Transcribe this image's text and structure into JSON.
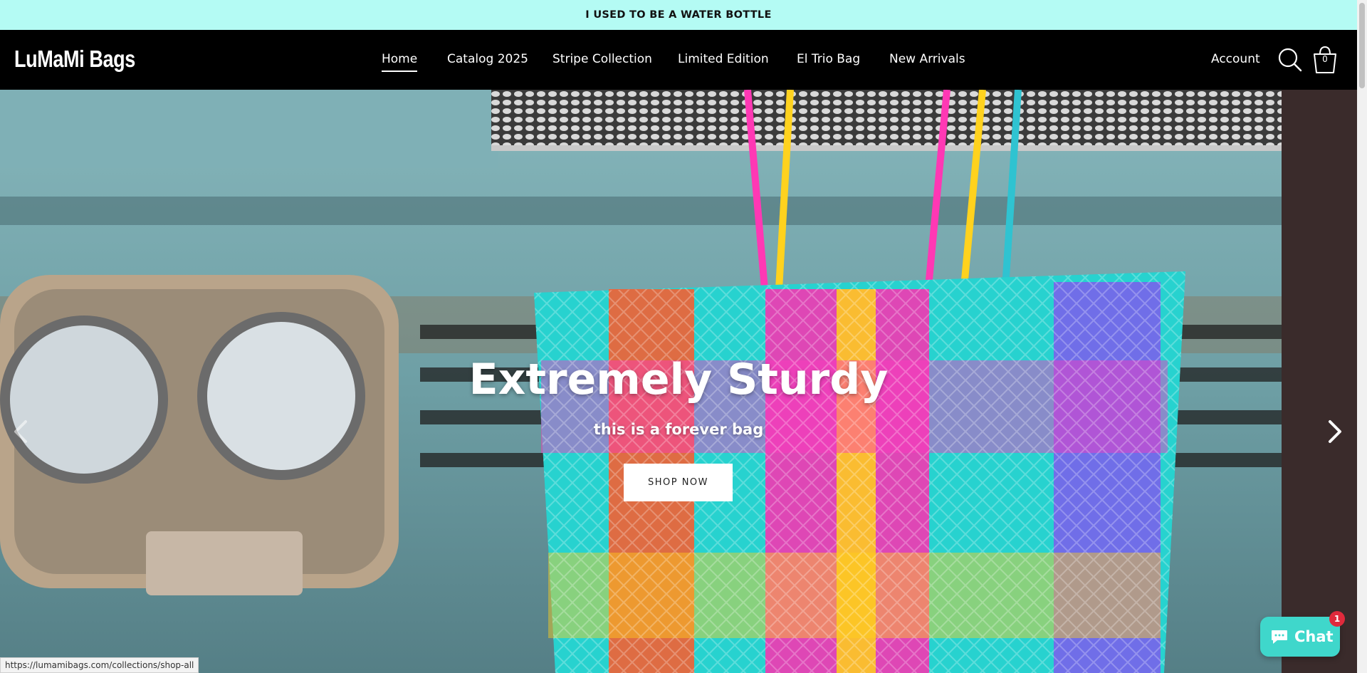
{
  "announcement": {
    "text": "I USED TO BE A WATER BOTTLE"
  },
  "header": {
    "logo": "LuMaMi Bags",
    "nav": [
      {
        "label": "Home",
        "active": true
      },
      {
        "label": "Catalog 2025"
      },
      {
        "label": "Stripe Collection"
      },
      {
        "label": "Limited Edition"
      },
      {
        "label": "El Trio Bag"
      },
      {
        "label": "New Arrivals"
      }
    ],
    "account_label": "Account",
    "icons": {
      "search": "search-icon",
      "cart": "cart-icon"
    },
    "cart_count": "0"
  },
  "hero": {
    "title": "Extremely Sturdy",
    "subtitle": "this is a forever bag",
    "cta_label": "SHOP NOW"
  },
  "status_bar": {
    "url": "https://lumamibags.com/collections/shop-all"
  },
  "chat": {
    "label": "Chat",
    "badge_count": "1"
  },
  "colors": {
    "announcement_bg": "#b4fbf4",
    "header_bg": "#000000",
    "chat_bg": "#3fd7cb",
    "badge": "#e02a3c"
  }
}
